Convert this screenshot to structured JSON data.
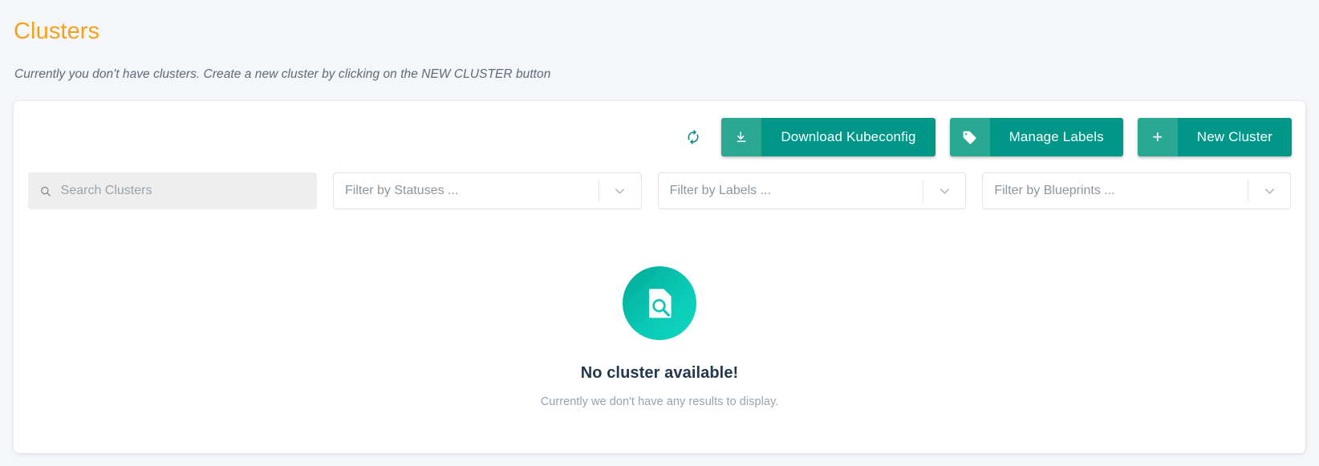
{
  "header": {
    "title": "Clusters",
    "subtitle": "Currently you don't have clusters. Create a new cluster by clicking on the NEW CLUSTER button"
  },
  "toolbar": {
    "refresh_icon": "refresh-icon",
    "buttons": [
      {
        "icon": "download-icon",
        "label": "Download Kubeconfig"
      },
      {
        "icon": "tag-icon",
        "label": "Manage Labels"
      },
      {
        "icon": "plus-icon",
        "label": "New Cluster"
      }
    ]
  },
  "filters": {
    "search": {
      "icon": "search-icon",
      "value": "",
      "placeholder": "Search Clusters"
    },
    "selects": [
      {
        "name": "statuses",
        "value": "Filter by Statuses ...",
        "arrow_icon": "chevron-down-icon"
      },
      {
        "name": "labels",
        "value": "Filter by Labels ...",
        "arrow_icon": "chevron-down-icon"
      },
      {
        "name": "blueprints",
        "value": "Filter by Blueprints ...",
        "arrow_icon": "chevron-down-icon"
      }
    ]
  },
  "empty_state": {
    "icon": "document-search-icon",
    "title": "No cluster available!",
    "subtitle": "Currently we don't have any results to display."
  },
  "colors": {
    "page_background": "#f4f6f9",
    "title_orange": "#f6a11e",
    "button_teal": "#009688",
    "button_teal_light": "#2aa893",
    "empty_title": "#22384f"
  }
}
